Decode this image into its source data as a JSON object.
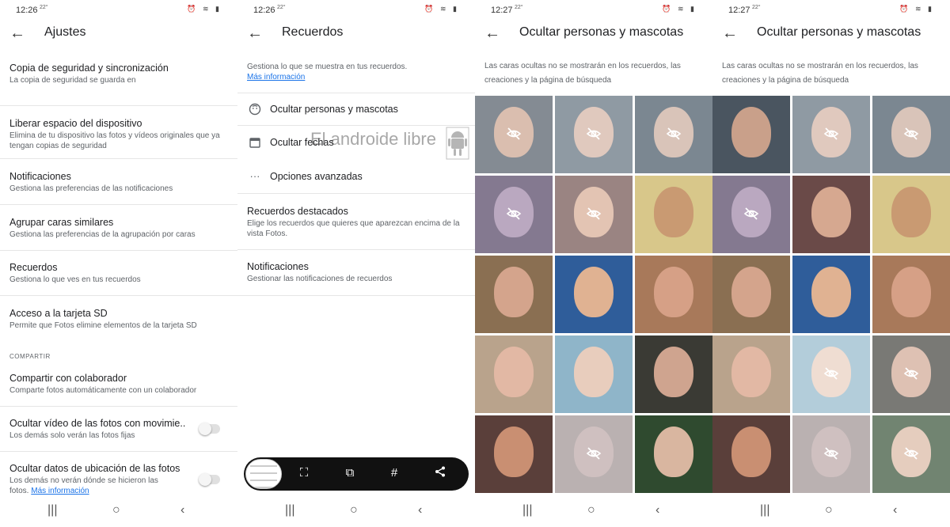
{
  "colors": {
    "link": "#1a73e8",
    "text_primary": "#202124",
    "text_secondary": "#5f6368",
    "bottom_bar": "#111111"
  },
  "panels": [
    {
      "status": {
        "time": "12:26",
        "extra": "22°"
      },
      "title": "Ajustes"
    },
    {
      "status": {
        "time": "12:26",
        "extra": "22°"
      },
      "title": "Recuerdos"
    },
    {
      "status": {
        "time": "12:27",
        "extra": "22°"
      },
      "title": "Ocultar personas y mascotas"
    },
    {
      "status": {
        "time": "12:27",
        "extra": "22°"
      },
      "title": "Ocultar personas y mascotas"
    }
  ],
  "settings": {
    "items": [
      {
        "title": "Copia de seguridad y sincronización",
        "subtitle": "La copia de seguridad se guarda en"
      },
      {
        "title": "Liberar espacio del dispositivo",
        "subtitle": "Elimina de tu dispositivo las fotos y vídeos originales que ya tengan copias de seguridad"
      },
      {
        "title": "Notificaciones",
        "subtitle": "Gestiona las preferencias de las notificaciones"
      },
      {
        "title": "Agrupar caras similares",
        "subtitle": "Gestiona las preferencias de la agrupación por caras"
      },
      {
        "title": "Recuerdos",
        "subtitle": "Gestiona lo que ves en tus recuerdos"
      },
      {
        "title": "Acceso a la tarjeta SD",
        "subtitle": "Permite que Fotos elimine elementos de la tarjeta SD"
      }
    ],
    "section": "COMPARTIR",
    "share": {
      "title": "Compartir con colaborador",
      "subtitle": "Comparte fotos automáticamente con un colaborador"
    },
    "motion": {
      "title": "Ocultar vídeo de las fotos con movimie..",
      "subtitle": "Los demás solo verán las fotos fijas",
      "enabled": false
    },
    "location": {
      "title": "Ocultar datos de ubicación de las fotos",
      "subtitle": "Los demás no verán dónde se hicieron las fotos.",
      "link": "Más información",
      "enabled": false
    }
  },
  "recuerdos": {
    "intro": "Gestiona lo que se muestra en tus recuerdos.",
    "intro_link": "Más información",
    "menu": [
      {
        "icon": "face-icon",
        "label": "Ocultar personas y mascotas"
      },
      {
        "icon": "calendar-icon",
        "label": "Ocultar fechas"
      },
      {
        "icon": "more-horiz-icon",
        "label": "Opciones avanzadas"
      }
    ],
    "featured": {
      "title": "Recuerdos destacados",
      "subtitle": "Elige los recuerdos que quieres que aparezcan encima de la vista Fotos."
    },
    "notifications": {
      "title": "Notificaciones",
      "subtitle": "Gestionar las notificaciones de recuerdos"
    },
    "watermark": "El androide libre",
    "bottom_actions": [
      "screenshot-scan-icon",
      "crop-edit-icon",
      "hashtag-icon",
      "share-icon"
    ],
    "bottom_hash": "#"
  },
  "hide_people": {
    "description": "Las caras ocultas no se mostrarán en los recuerdos, las creaciones y la página de búsqueda",
    "hidden_before": [
      true,
      true,
      true,
      true,
      true,
      false,
      false,
      false,
      false,
      false,
      false,
      false,
      false,
      true,
      false
    ],
    "hidden_after": [
      false,
      true,
      true,
      true,
      false,
      false,
      false,
      false,
      false,
      false,
      true,
      true,
      false,
      true,
      true
    ]
  },
  "navbar": {
    "recent": "|||",
    "home": "○",
    "back": "‹"
  }
}
